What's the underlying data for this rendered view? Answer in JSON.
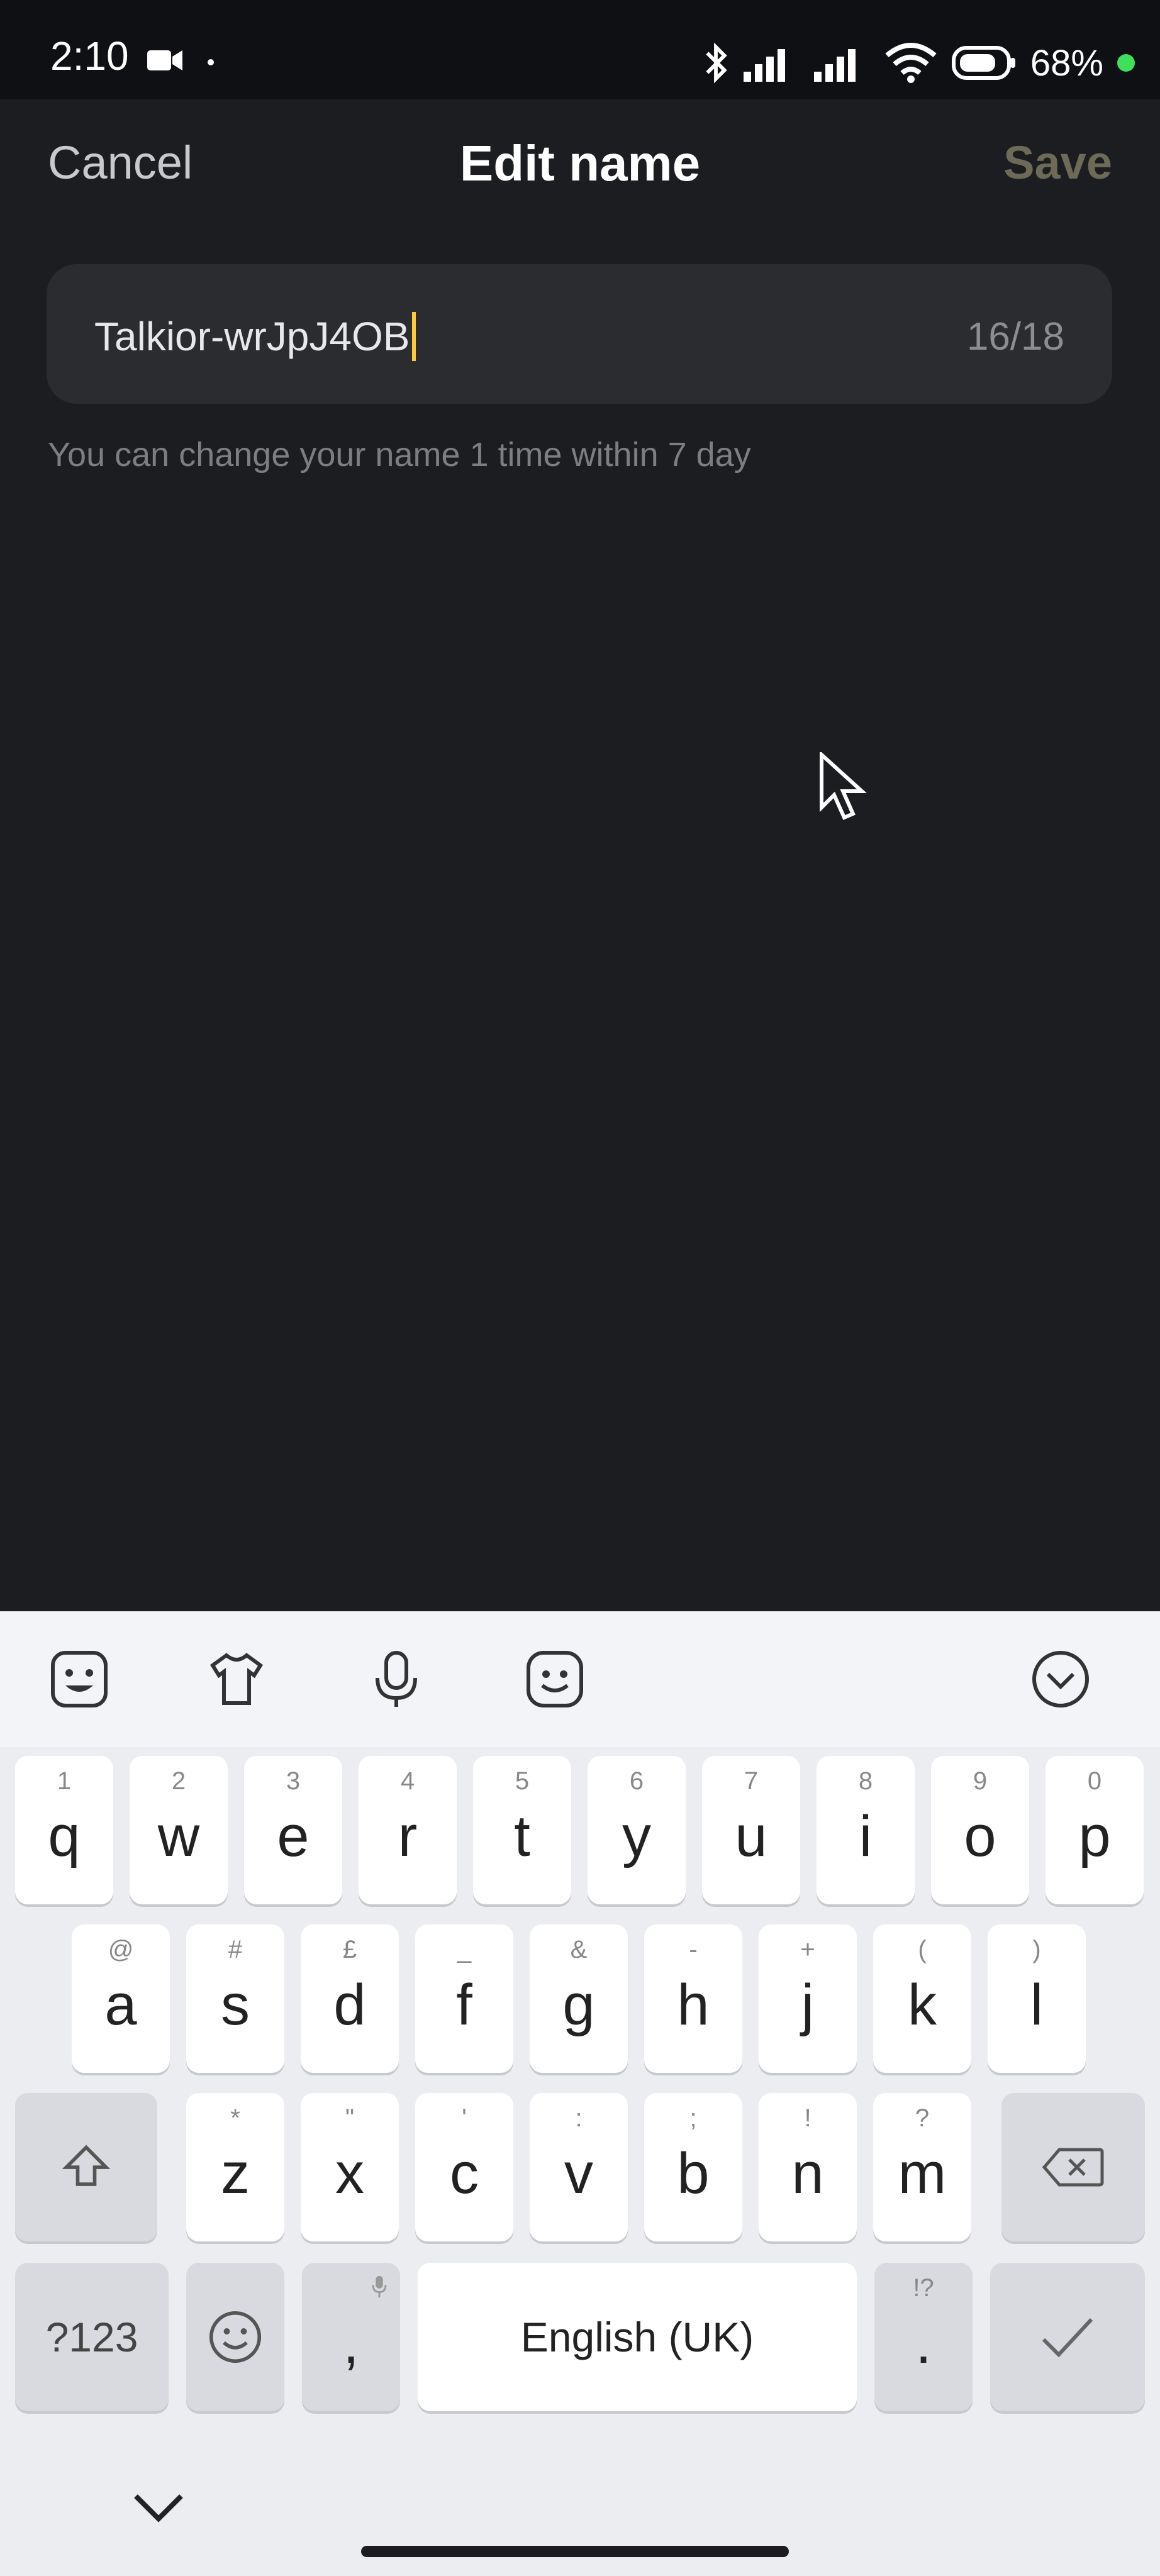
{
  "status": {
    "time": "2:10",
    "battery": "68%"
  },
  "header": {
    "cancel": "Cancel",
    "title": "Edit name",
    "save": "Save"
  },
  "name_field": {
    "value": "Talkior-wrJpJ4OB",
    "counter": "16/18"
  },
  "hint": "You can change your name 1 time within 7 day",
  "keyboard": {
    "row1": [
      {
        "sup": "1",
        "key": "q"
      },
      {
        "sup": "2",
        "key": "w"
      },
      {
        "sup": "3",
        "key": "e"
      },
      {
        "sup": "4",
        "key": "r"
      },
      {
        "sup": "5",
        "key": "t"
      },
      {
        "sup": "6",
        "key": "y"
      },
      {
        "sup": "7",
        "key": "u"
      },
      {
        "sup": "8",
        "key": "i"
      },
      {
        "sup": "9",
        "key": "o"
      },
      {
        "sup": "0",
        "key": "p"
      }
    ],
    "row2": [
      {
        "sup": "@",
        "key": "a"
      },
      {
        "sup": "#",
        "key": "s"
      },
      {
        "sup": "£",
        "key": "d"
      },
      {
        "sup": "_",
        "key": "f"
      },
      {
        "sup": "&",
        "key": "g"
      },
      {
        "sup": "-",
        "key": "h"
      },
      {
        "sup": "+",
        "key": "j"
      },
      {
        "sup": "(",
        "key": "k"
      },
      {
        "sup": ")",
        "key": "l"
      }
    ],
    "row3": [
      {
        "sup": "*",
        "key": "z"
      },
      {
        "sup": "\"",
        "key": "x"
      },
      {
        "sup": "'",
        "key": "c"
      },
      {
        "sup": ":",
        "key": "v"
      },
      {
        "sup": ";",
        "key": "b"
      },
      {
        "sup": "!",
        "key": "n"
      },
      {
        "sup": "?",
        "key": "m"
      }
    ],
    "symbols": "?123",
    "comma": ",",
    "space": "English (UK)",
    "period_sup": "!?",
    "period": "."
  }
}
